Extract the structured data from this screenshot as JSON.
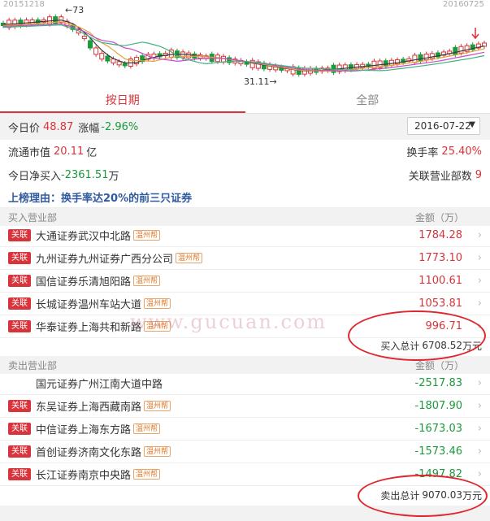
{
  "chart": {
    "start_date": "20151218",
    "end_date": "20160725",
    "high_label": "73",
    "low_label": "31.11",
    "colors": {
      "up": "#d9343b",
      "down": "#1c9a3c",
      "ma5": "#3a3a3a",
      "ma10": "#e6a23c",
      "ma20": "#c64ac9",
      "ma60": "#3fb37f"
    }
  },
  "tabs": [
    {
      "label": "按日期",
      "active": true
    },
    {
      "label": "全部",
      "active": false
    }
  ],
  "summary": {
    "price_label": "今日价",
    "price": "48.87",
    "change_label": "涨幅",
    "change": "-2.96%",
    "date": "2016-07-22",
    "float_cap_label": "流通市值",
    "float_cap": "20.11",
    "float_cap_unit": "亿",
    "turnover_label": "换手率",
    "turnover": "25.40%",
    "net_buy_label": "今日净买入",
    "net_buy": "-2361.51",
    "net_buy_unit": "万",
    "dept_count_label": "关联营业部数",
    "dept_count": "9"
  },
  "reason": "上榜理由：换手率达20%的前三只证券",
  "buy": {
    "header": "买入营业部",
    "amount_header": "金额（万）",
    "rows": [
      {
        "tag": "关联",
        "name": "大通证券武汉中北路",
        "badge": "温州帮",
        "amount": "1784.28"
      },
      {
        "tag": "关联",
        "name": "九州证券九州证券广西分公司",
        "badge": "温州帮",
        "amount": "1773.10"
      },
      {
        "tag": "关联",
        "name": "国信证券乐清旭阳路",
        "badge": "温州帮",
        "amount": "1100.61"
      },
      {
        "tag": "关联",
        "name": "长城证券温州车站大道",
        "badge": "温州帮",
        "amount": "1053.81"
      },
      {
        "tag": "关联",
        "name": "华泰证券上海共和新路",
        "badge": "温州帮",
        "amount": "996.71"
      }
    ],
    "total_label": "买入总计",
    "total": "6708.52",
    "total_unit": "万元"
  },
  "sell": {
    "header": "卖出营业部",
    "amount_header": "金额（万）",
    "rows": [
      {
        "tag": "",
        "name": "国元证券广州江南大道中路",
        "badge": "",
        "amount": "-2517.83"
      },
      {
        "tag": "关联",
        "name": "东吴证券上海西藏南路",
        "badge": "温州帮",
        "amount": "-1807.90"
      },
      {
        "tag": "关联",
        "name": "中信证券上海东方路",
        "badge": "温州帮",
        "amount": "-1673.03"
      },
      {
        "tag": "关联",
        "name": "首创证券济南文化东路",
        "badge": "温州帮",
        "amount": "-1573.46"
      },
      {
        "tag": "关联",
        "name": "长江证券南京中央路",
        "badge": "温州帮",
        "amount": "-1497.82"
      }
    ],
    "total_label": "卖出总计",
    "total": "9070.03",
    "total_unit": "万元"
  },
  "watermark": "www.gucuan.com"
}
